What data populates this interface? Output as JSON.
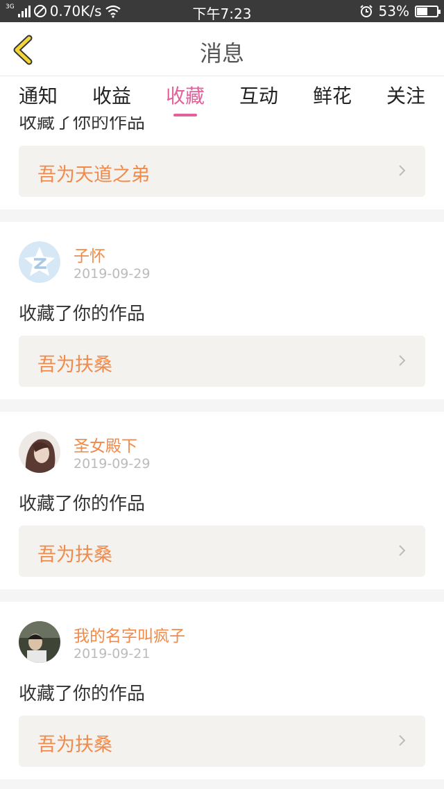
{
  "status_bar": {
    "network": "3G",
    "speed": "0.70K/s",
    "time": "下午7:23",
    "battery": "53%",
    "battery_level": 0.53
  },
  "header": {
    "title": "消息",
    "back_icon": "chevron-left-icon",
    "accent_color": "#f2d63b"
  },
  "tabs": [
    {
      "label": "通知",
      "active": false
    },
    {
      "label": "收益",
      "active": false
    },
    {
      "label": "收藏",
      "active": true
    },
    {
      "label": "互动",
      "active": false
    },
    {
      "label": "鲜花",
      "active": false
    },
    {
      "label": "关注",
      "active": false
    }
  ],
  "active_color": "#e3609a",
  "messages": [
    {
      "action": "收藏了你的作品",
      "work": "吾为天道之弟"
    },
    {
      "user": "子怀",
      "date": "2019-09-29",
      "action": "收藏了你的作品",
      "work": "吾为扶桑",
      "avatar": "qzone-avatar"
    },
    {
      "user": "圣女殿下",
      "date": "2019-09-29",
      "action": "收藏了你的作品",
      "work": "吾为扶桑",
      "avatar": "photo-avatar"
    },
    {
      "user": "我的名字叫疯子",
      "date": "2019-09-21",
      "action": "收藏了你的作品",
      "work": "吾为扶桑",
      "avatar": "photo-avatar"
    }
  ]
}
